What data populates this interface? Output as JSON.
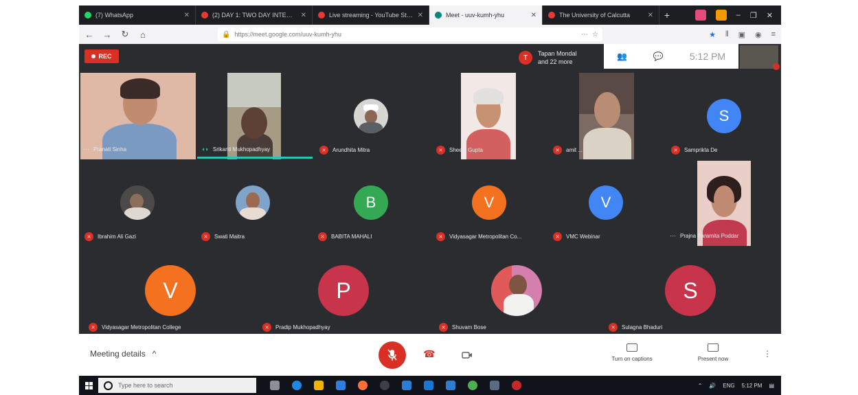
{
  "browser": {
    "tabs": [
      {
        "label": "(7) WhatsApp",
        "color": "#25d366",
        "active": false
      },
      {
        "label": "(2) DAY 1: TWO DAY INTERNATI...",
        "color": "#e53935",
        "active": false
      },
      {
        "label": "Live streaming - YouTube Stu...",
        "color": "#e53935",
        "active": false
      },
      {
        "label": "Meet - uuv-kumh-yhu",
        "color": "#00897b",
        "active": true
      },
      {
        "label": "The University of Calcutta",
        "color": "#e53935",
        "active": false
      }
    ],
    "new_tab_label": "+",
    "url": "https://meet.google.com/uuv-kumh-yhu"
  },
  "meet": {
    "rec_label": "REC",
    "presenter": {
      "initial": "T",
      "line1": "Tapan Mondal",
      "line2": "and 22 more"
    },
    "clock": "5:12 PM",
    "participants": [
      {
        "name": "Pranati Sinha",
        "kind": "video",
        "muted": false
      },
      {
        "name": "Srikanti Mukhopadhyay",
        "kind": "video",
        "muted": false,
        "speaking": true
      },
      {
        "name": "Arundhita Mitra",
        "kind": "photo",
        "muted": true
      },
      {
        "name": "Sheela Gupta",
        "kind": "video",
        "muted": true
      },
      {
        "name": "amit ...",
        "kind": "video",
        "muted": true
      },
      {
        "name": "Samprikta De",
        "kind": "avatar",
        "letter": "S",
        "color": "#4285f4",
        "muted": true
      },
      {
        "name": "Ibrahim Ali Gazi",
        "kind": "photo",
        "muted": true
      },
      {
        "name": "Swati Maitra",
        "kind": "photo",
        "muted": true
      },
      {
        "name": "BABITA MAHALI",
        "kind": "avatar",
        "letter": "B",
        "color": "#34a853",
        "muted": true
      },
      {
        "name": "Vidyasagar Metropolitan Co...",
        "kind": "avatar",
        "letter": "V",
        "color": "#f4711f",
        "muted": true
      },
      {
        "name": "VMC Webinar",
        "kind": "avatar",
        "letter": "V",
        "color": "#4285f4",
        "muted": true
      },
      {
        "name": "Prajna Paramita Poddar",
        "kind": "video",
        "muted": false
      },
      {
        "name": "Vidyasagar Metropolitan College",
        "kind": "avatar",
        "letter": "V",
        "color": "#f4711f",
        "muted": true
      },
      {
        "name": "Pradip Mukhopadhyay",
        "kind": "avatar",
        "letter": "P",
        "color": "#c8344a",
        "muted": true
      },
      {
        "name": "Shuvam Bose",
        "kind": "photo",
        "muted": true
      },
      {
        "name": "Sulagna Bhaduri",
        "kind": "avatar",
        "letter": "S",
        "color": "#c8344a",
        "muted": true
      }
    ],
    "bottom": {
      "details_label": "Meeting details",
      "captions_label": "Turn on captions",
      "present_label": "Present now"
    }
  },
  "taskbar": {
    "search_placeholder": "Type here to search",
    "time": "5:12 PM",
    "lang": "ENG"
  }
}
